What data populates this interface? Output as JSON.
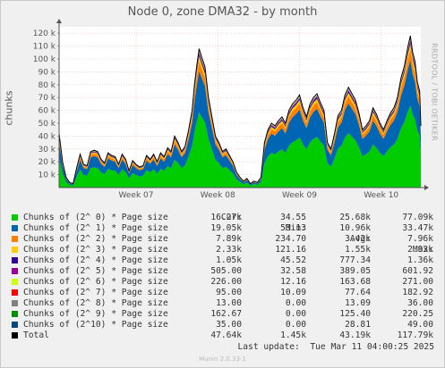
{
  "title": "Node 0, zone DMA32 - by month",
  "y_axis_label": "chunks",
  "watermark": "RRDTOOL / TOBI OETIKER",
  "legend_headers": {
    "cur": "Cur:",
    "min": "Min:",
    "avg": "Avg:",
    "max": "Max:"
  },
  "legend": [
    {
      "label": "Chunks of (2^ 0) * Page size",
      "color": "#00cc00",
      "cur": "16.27k",
      "min": "34.55",
      "avg": "25.68k",
      "max": "77.09k"
    },
    {
      "label": "Chunks of (2^ 1) * Page size",
      "color": "#0066b3",
      "cur": "19.05k",
      "min": "53.13",
      "avg": "10.96k",
      "max": "33.47k"
    },
    {
      "label": "Chunks of (2^ 2) * Page size",
      "color": "#ff8000",
      "cur": "7.89k",
      "min": "234.70",
      "avg": "3.42k",
      "max": "7.96k"
    },
    {
      "label": "Chunks of (2^ 3) * Page size",
      "color": "#ffcc00",
      "cur": "2.33k",
      "min": "121.16",
      "avg": "1.55k",
      "max": "2.93k"
    },
    {
      "label": "Chunks of (2^ 4) * Page size",
      "color": "#330099",
      "cur": "1.05k",
      "min": "45.52",
      "avg": "777.34",
      "max": "1.36k"
    },
    {
      "label": "Chunks of (2^ 5) * Page size",
      "color": "#990099",
      "cur": "505.00",
      "min": "32.58",
      "avg": "389.05",
      "max": "601.92"
    },
    {
      "label": "Chunks of (2^ 6) * Page size",
      "color": "#ccff00",
      "cur": "226.00",
      "min": "12.16",
      "avg": "163.68",
      "max": "271.00"
    },
    {
      "label": "Chunks of (2^ 7) * Page size",
      "color": "#ff0000",
      "cur": "95.00",
      "min": "10.09",
      "avg": "77.64",
      "max": "182.92"
    },
    {
      "label": "Chunks of (2^ 8) * Page size",
      "color": "#808080",
      "cur": "13.00",
      "min": "0.00",
      "avg": "13.09",
      "max": "36.00"
    },
    {
      "label": "Chunks of (2^ 9) * Page size",
      "color": "#008f00",
      "cur": "162.67",
      "min": "0.00",
      "avg": "125.40",
      "max": "220.25"
    },
    {
      "label": "Chunks of (2^10) * Page size",
      "color": "#00487d",
      "cur": "35.00",
      "min": "0.00",
      "avg": "28.81",
      "max": "49.00"
    },
    {
      "label": "Total",
      "color": "#000000",
      "cur": "47.64k",
      "min": "1.45k",
      "avg": "43.19k",
      "max": "117.79k"
    }
  ],
  "last_update": "Last update:  Tue Mar 11 04:00:25 2025",
  "footer": "Munin 2.0.33-1",
  "chart_data": {
    "type": "area",
    "stacked": true,
    "ylim": [
      0,
      125000
    ],
    "y_ticks": [
      {
        "value": 10000,
        "label": "10 k"
      },
      {
        "value": 20000,
        "label": "20 k"
      },
      {
        "value": 30000,
        "label": "30 k"
      },
      {
        "value": 40000,
        "label": "40 k"
      },
      {
        "value": 50000,
        "label": "50 k"
      },
      {
        "value": 60000,
        "label": "60 k"
      },
      {
        "value": 70000,
        "label": "70 k"
      },
      {
        "value": 80000,
        "label": "80 k"
      },
      {
        "value": 90000,
        "label": "90 k"
      },
      {
        "value": 100000,
        "label": "100 k"
      },
      {
        "value": 110000,
        "label": "110 k"
      },
      {
        "value": 120000,
        "label": "120 k"
      }
    ],
    "x_range_days": [
      0,
      31
    ],
    "x_ticks": [
      {
        "day": 6.6,
        "label": "Week 07"
      },
      {
        "day": 13.6,
        "label": "Week 08"
      },
      {
        "day": 20.6,
        "label": "Week 09"
      },
      {
        "day": 27.6,
        "label": "Week 10"
      }
    ],
    "total_points": [
      [
        0,
        42000
      ],
      [
        0.3,
        20000
      ],
      [
        0.6,
        8000
      ],
      [
        0.9,
        4000
      ],
      [
        1.2,
        3000
      ],
      [
        1.5,
        15000
      ],
      [
        1.8,
        26000
      ],
      [
        2.1,
        18000
      ],
      [
        2.4,
        17000
      ],
      [
        2.7,
        28000
      ],
      [
        3.0,
        29000
      ],
      [
        3.3,
        28000
      ],
      [
        3.6,
        22000
      ],
      [
        3.9,
        19000
      ],
      [
        4.2,
        27000
      ],
      [
        4.5,
        25000
      ],
      [
        4.8,
        24000
      ],
      [
        5.1,
        18000
      ],
      [
        5.4,
        26000
      ],
      [
        5.7,
        22000
      ],
      [
        6.0,
        13000
      ],
      [
        6.3,
        21000
      ],
      [
        6.6,
        18000
      ],
      [
        6.9,
        16000
      ],
      [
        7.2,
        17000
      ],
      [
        7.5,
        25000
      ],
      [
        7.8,
        22000
      ],
      [
        8.1,
        26000
      ],
      [
        8.4,
        20000
      ],
      [
        8.7,
        27000
      ],
      [
        9.0,
        24000
      ],
      [
        9.3,
        31000
      ],
      [
        9.6,
        28000
      ],
      [
        9.9,
        40000
      ],
      [
        10.2,
        35000
      ],
      [
        10.5,
        28000
      ],
      [
        10.8,
        32000
      ],
      [
        11.1,
        45000
      ],
      [
        11.4,
        60000
      ],
      [
        11.6,
        80000
      ],
      [
        11.8,
        95000
      ],
      [
        12.0,
        108000
      ],
      [
        12.2,
        102000
      ],
      [
        12.5,
        94000
      ],
      [
        12.8,
        70000
      ],
      [
        13.1,
        55000
      ],
      [
        13.4,
        40000
      ],
      [
        13.7,
        35000
      ],
      [
        14.0,
        28000
      ],
      [
        14.3,
        30000
      ],
      [
        14.6,
        25000
      ],
      [
        14.9,
        20000
      ],
      [
        15.2,
        12000
      ],
      [
        15.5,
        8000
      ],
      [
        15.8,
        5000
      ],
      [
        16.1,
        7000
      ],
      [
        16.4,
        3000
      ],
      [
        16.7,
        5000
      ],
      [
        17.0,
        4000
      ],
      [
        17.3,
        8000
      ],
      [
        17.6,
        35000
      ],
      [
        17.9,
        45000
      ],
      [
        18.2,
        50000
      ],
      [
        18.5,
        48000
      ],
      [
        18.8,
        52000
      ],
      [
        19.1,
        55000
      ],
      [
        19.4,
        50000
      ],
      [
        19.7,
        60000
      ],
      [
        20.0,
        65000
      ],
      [
        20.3,
        68000
      ],
      [
        20.6,
        72000
      ],
      [
        20.9,
        62000
      ],
      [
        21.2,
        55000
      ],
      [
        21.5,
        65000
      ],
      [
        21.8,
        70000
      ],
      [
        22.1,
        73000
      ],
      [
        22.4,
        66000
      ],
      [
        22.7,
        60000
      ],
      [
        23.0,
        35000
      ],
      [
        23.3,
        30000
      ],
      [
        23.6,
        42000
      ],
      [
        23.9,
        56000
      ],
      [
        24.2,
        60000
      ],
      [
        24.5,
        72000
      ],
      [
        24.8,
        78000
      ],
      [
        25.1,
        73000
      ],
      [
        25.4,
        68000
      ],
      [
        25.7,
        58000
      ],
      [
        26.0,
        45000
      ],
      [
        26.3,
        48000
      ],
      [
        26.6,
        52000
      ],
      [
        26.9,
        62000
      ],
      [
        27.2,
        57000
      ],
      [
        27.5,
        50000
      ],
      [
        27.8,
        45000
      ],
      [
        28.1,
        52000
      ],
      [
        28.4,
        58000
      ],
      [
        28.7,
        62000
      ],
      [
        29.0,
        70000
      ],
      [
        29.3,
        85000
      ],
      [
        29.6,
        95000
      ],
      [
        29.9,
        110000
      ],
      [
        30.1,
        118000
      ],
      [
        30.3,
        105000
      ],
      [
        30.5,
        98000
      ],
      [
        30.7,
        82000
      ],
      [
        30.9,
        75000
      ],
      [
        31.0,
        48000
      ]
    ],
    "layer_fractions": [
      0.54,
      0.3,
      0.07,
      0.035,
      0.018,
      0.009,
      0.004,
      0.002,
      0.002,
      0.003,
      0.001
    ]
  }
}
